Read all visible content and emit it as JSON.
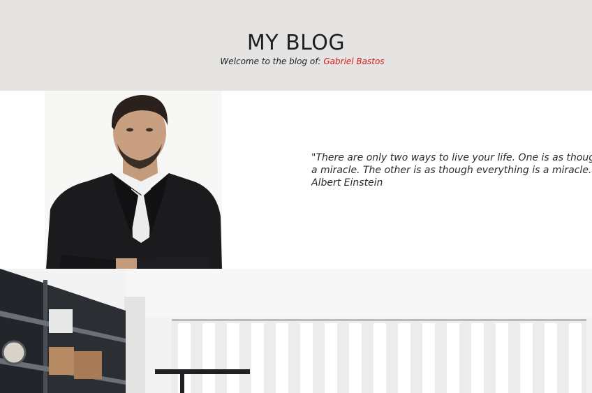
{
  "header": {
    "title": "MY BLOG",
    "welcome_prefix": "Welcome to the blog of:",
    "author_name": "Gabriel Bastos"
  },
  "intro": {
    "quote_line_1": "\"There are only two ways to live your life. One is as though nothing is",
    "quote_line_2": "a miracle. The other is as though everything is a miracle.\"",
    "quote_author": "Albert Einstein"
  },
  "colors": {
    "header_background": "#e5e4e2",
    "author_link": "#d21a1a"
  },
  "icons": [
    "author-portrait-photo",
    "office-interior-photo"
  ]
}
